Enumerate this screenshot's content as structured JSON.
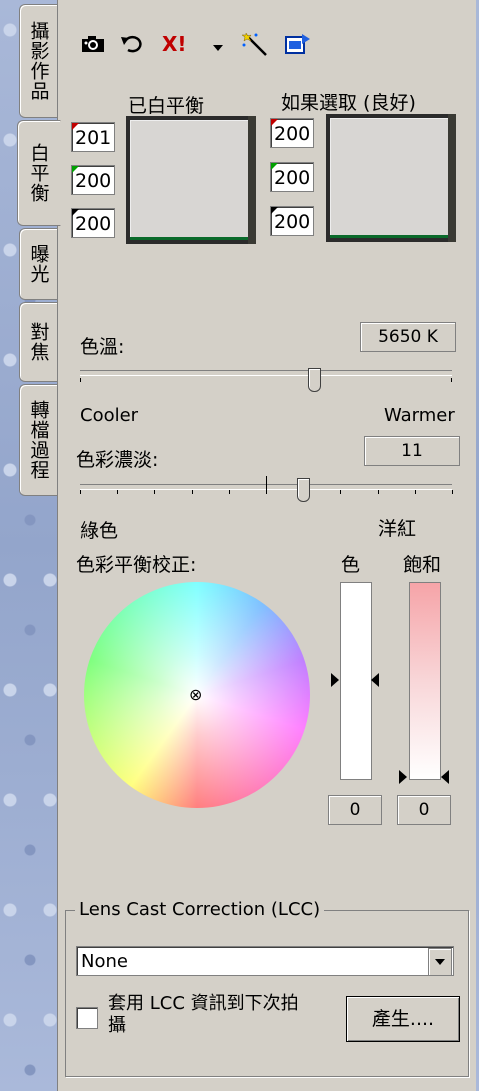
{
  "tabs": [
    "攝影作品",
    "白平衡",
    "曝光",
    "對焦",
    "轉檔過程"
  ],
  "toolbar": {
    "icons": [
      "camera-icon",
      "undo-icon",
      "reset-icon",
      "dropdown-icon",
      "wand-icon",
      "apply-icon"
    ],
    "reset_glyph": "X!"
  },
  "white_balance": {
    "left_title": "已白平衡",
    "right_title": "如果選取 (良好)",
    "left_values": [
      "201",
      "200",
      "200"
    ],
    "right_values": [
      "200",
      "200",
      "200"
    ],
    "channel_colors": [
      "#c00000",
      "#00a000",
      "#000000"
    ]
  },
  "temperature": {
    "label": "色溫:",
    "value": "5650 K",
    "min_label": "Cooler",
    "max_label": "Warmer",
    "level": 0.63
  },
  "tint": {
    "label": "色彩濃淡:",
    "value": "11",
    "min_label": "綠色",
    "max_label": "洋紅",
    "level": 0.6
  },
  "color_balance": {
    "label": "色彩平衡校正:",
    "hue_label": "色",
    "sat_label": "飽和",
    "hue_value": "0",
    "sat_value": "0"
  },
  "lcc": {
    "legend": "Lens Cast Correction (LCC)",
    "select_value": "None",
    "checkbox_label_line1": "套用 LCC 資訊到下次拍",
    "checkbox_label_line2": "攝",
    "generate_button": "產生...."
  }
}
